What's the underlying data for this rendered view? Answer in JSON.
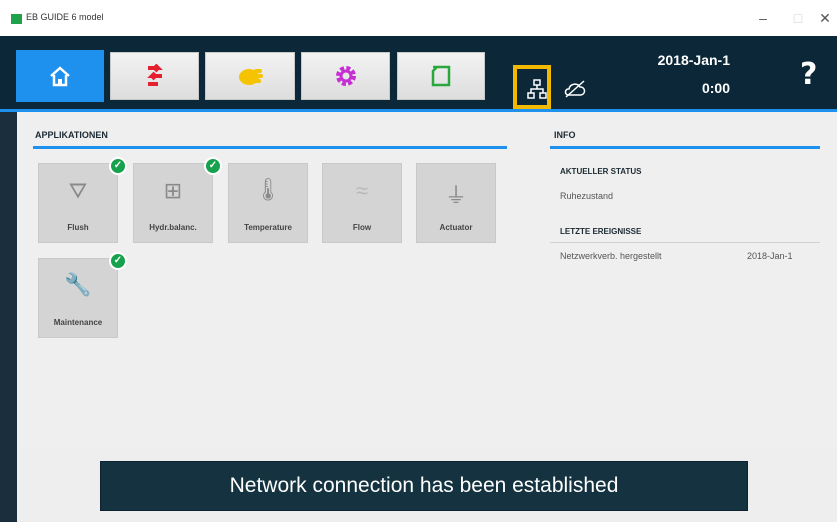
{
  "window": {
    "title": "EB GUIDE 6 model"
  },
  "window_controls": {
    "minimize": "–",
    "maximize": "□",
    "close": "✕"
  },
  "toolbar": {
    "tabs": [
      {
        "icon": "home-icon",
        "active": true
      },
      {
        "icon": "swap-arrows-icon"
      },
      {
        "icon": "hand-icon"
      },
      {
        "icon": "gear-icon"
      },
      {
        "icon": "folder-icon"
      }
    ],
    "status_icons": [
      "network-icon",
      "no-cloud-icon"
    ],
    "date": "2018-Jan-1",
    "time": "0:00",
    "help": "?"
  },
  "applications": {
    "title": "APPLIKATIONEN",
    "tiles": [
      {
        "label": "Flush",
        "glyph": "⛛",
        "icon": "flush-icon",
        "checked": true
      },
      {
        "label": "Hydr.balanc.",
        "glyph": "⊞",
        "icon": "hydraulic-balance-icon",
        "checked": true
      },
      {
        "label": "Temperature",
        "glyph": "🌡",
        "icon": "thermometer-icon",
        "checked": false
      },
      {
        "label": "Flow",
        "glyph": "≈",
        "icon": "flow-icon",
        "checked": false
      },
      {
        "label": "Actuator",
        "glyph": "⏚",
        "icon": "actuator-icon",
        "checked": false
      },
      {
        "label": "Maintenance",
        "glyph": "🔧",
        "icon": "wrench-icon",
        "checked": true
      }
    ]
  },
  "info": {
    "title": "INFO",
    "current_status_label": "AKTUELLER STATUS",
    "current_status_value": "Ruhezustand",
    "events_label": "LETZTE EREIGNISSE",
    "events": [
      {
        "text": "Netzwerkverb. hergestellt",
        "date": "2018-Jan-1"
      }
    ]
  },
  "notification": {
    "text": "Network connection has been established"
  },
  "colors": {
    "accent": "#1e90ee",
    "dark": "#0c2738",
    "highlight": "#f3b800",
    "ok": "#16a14d"
  }
}
